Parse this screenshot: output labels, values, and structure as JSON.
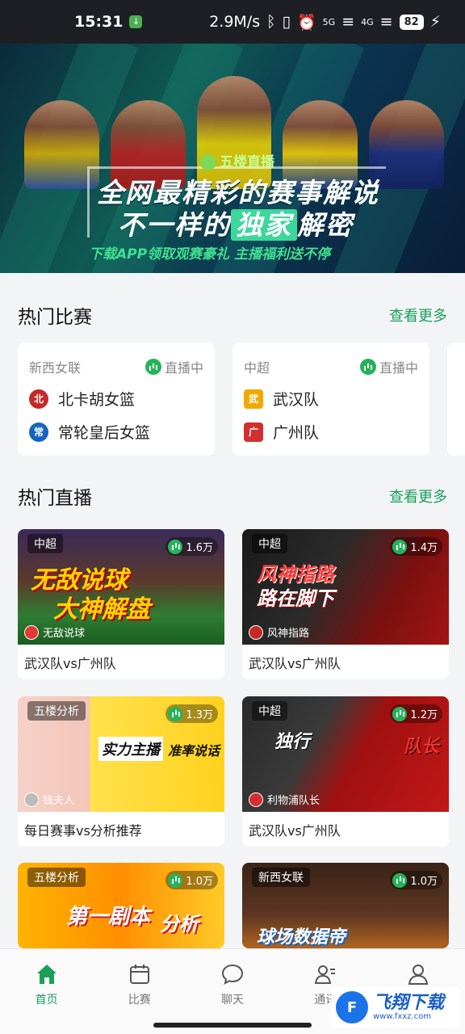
{
  "status_bar": {
    "time": "15:31",
    "speed": "2.9M/s",
    "net1": "5G",
    "net2": "4G",
    "battery": "82"
  },
  "banner": {
    "brand": "五楼直播",
    "headline1": "全网最精彩的赛事解说",
    "headline2_pre": "不一样的",
    "headline2_hl": "独家",
    "headline2_post": "解密",
    "subline": "下载APP领取观赛豪礼  主播福利送不停"
  },
  "hot_matches": {
    "title": "热门比赛",
    "more": "查看更多",
    "cards": [
      {
        "league": "新西女联",
        "status": "直播中",
        "team1": "北卡胡女篮",
        "team2": "常轮皇后女篮",
        "badge1": "北",
        "badge2": "常"
      },
      {
        "league": "中超",
        "status": "直播中",
        "team1": "武汉队",
        "team2": "广州队",
        "badge1": "武",
        "badge2": "广"
      }
    ]
  },
  "hot_live": {
    "title": "热门直播",
    "more": "查看更多",
    "cards": [
      {
        "tag": "中超",
        "views": "1.6万",
        "anchor": "无敌说球",
        "caption": "武汉队vs广州队",
        "art1": "无敌说球",
        "art2": "大神解盘"
      },
      {
        "tag": "中超",
        "views": "1.4万",
        "anchor": "风神指路",
        "caption": "武汉队vs广州队",
        "art1": "风神指路",
        "art2": "路在脚下"
      },
      {
        "tag": "五楼分析",
        "views": "1.3万",
        "anchor": "钱夫人",
        "caption": "每日赛事vs分析推荐",
        "art1": "实力主播",
        "art2": "准率说话"
      },
      {
        "tag": "中超",
        "views": "1.2万",
        "anchor": "利物浦队长",
        "caption": "武汉队vs广州队",
        "art1": "独行",
        "art2": "队长"
      },
      {
        "tag": "五楼分析",
        "views": "1.0万",
        "anchor": "",
        "caption": "",
        "art1": "第一剧本",
        "art2": "分析"
      },
      {
        "tag": "新西女联",
        "views": "1.0万",
        "anchor": "",
        "caption": "",
        "art1": "球场数据帝",
        "art2": ""
      }
    ]
  },
  "nav": [
    {
      "label": "首页",
      "active": true
    },
    {
      "label": "比赛",
      "active": false
    },
    {
      "label": "聊天",
      "active": false
    },
    {
      "label": "通讯",
      "active": false
    },
    {
      "label": "",
      "active": false
    }
  ],
  "watermark": {
    "text": "飞翔下载",
    "url": "www.fxxz.com"
  },
  "colors": {
    "accent": "#1aa05a",
    "live_icon": "#24b45c"
  }
}
